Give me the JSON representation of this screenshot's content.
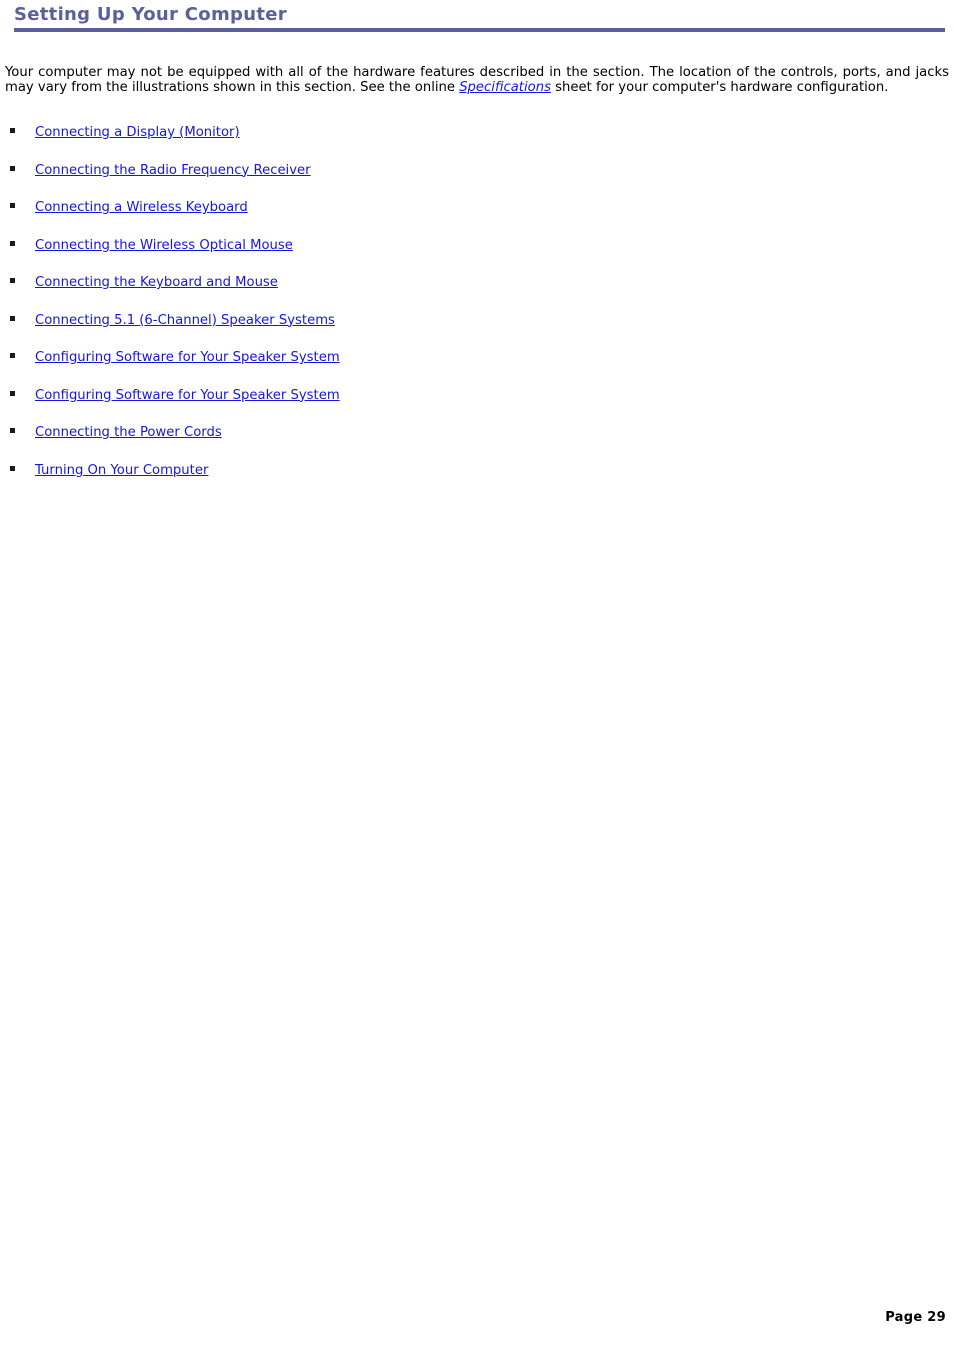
{
  "document": {
    "heading": "Setting Up Your Computer",
    "accent_color": "#5d5f99",
    "link_color": "#1616e0",
    "text_color": "#000000",
    "background_color": "#ffffff"
  },
  "intro": {
    "text_before_link": "Your computer may not be equipped with all of the hardware features described in the section. The location of the controls, ports, and jacks may vary from the illustrations shown in this section. See the online ",
    "link_text": "Specifications",
    "text_after_link": " sheet for your computer's hardware configuration."
  },
  "toc": {
    "bullet_glyph": "square-bullet-icon",
    "items": [
      {
        "label": "Connecting a Display (Monitor)"
      },
      {
        "label": "Connecting the Radio Frequency Receiver"
      },
      {
        "label": "Connecting a Wireless Keyboard"
      },
      {
        "label": "Connecting the Wireless Optical Mouse"
      },
      {
        "label": "Connecting the Keyboard and Mouse"
      },
      {
        "label": "Connecting 5.1 (6-Channel) Speaker Systems"
      },
      {
        "label": "Configuring Software for Your Speaker System"
      },
      {
        "label": "Configuring Software for Your Speaker System"
      },
      {
        "label": "Connecting the Power Cords"
      },
      {
        "label": "Turning On Your Computer"
      }
    ]
  },
  "footer": {
    "page_label": "Page 29"
  }
}
